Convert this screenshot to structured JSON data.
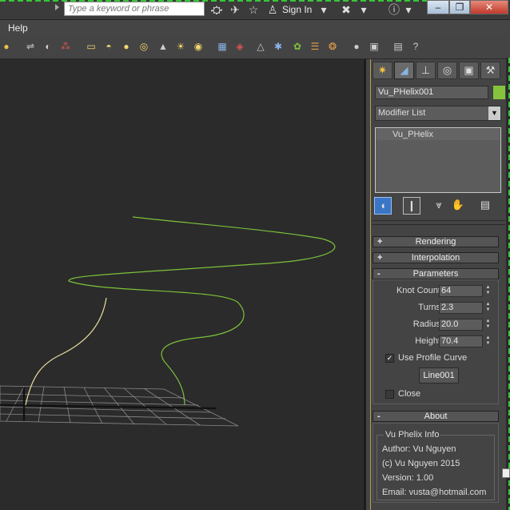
{
  "search": {
    "placeholder": "Type a keyword or phrase"
  },
  "titlebar": {
    "signin": "Sign In"
  },
  "menubar": {
    "help": "Help"
  },
  "panel": {
    "object_name": "Vu_PHelix001",
    "object_color": "#86c33c",
    "modifier_list": "Modifier List",
    "stack_items": [
      "Vu_PHelix"
    ],
    "rollouts": {
      "rendering": "Rendering",
      "interpolation": "Interpolation",
      "parameters": "Parameters",
      "about": "About"
    },
    "rollout_signs": {
      "collapsed": "+",
      "expanded": "-"
    },
    "parameters": {
      "knot_count": {
        "label": "Knot Count",
        "value": "64"
      },
      "turns": {
        "label": "Turns",
        "value": "2.3"
      },
      "radius": {
        "label": "Radius",
        "value": "20.0"
      },
      "height": {
        "label": "Height",
        "value": "70.4"
      },
      "use_profile_curve": {
        "label": "Use Profile Curve",
        "checked": true
      },
      "profile_button": "Line001",
      "close": {
        "label": "Close",
        "checked": false
      }
    },
    "about": {
      "group_title": "Vu Phelix Info",
      "author": "Author: Vu Nguyen",
      "copyright": "(c) Vu Nguyen 2015",
      "version": "Version: 1.00",
      "email": "Email: vusta@hotmail.com"
    }
  },
  "colors": {
    "helix": "#7cc23a",
    "profile_curve": "#e8e0a0",
    "grid": "#8a8a8a",
    "viewport_bg": "#2b2b2b",
    "panel_accent": "#b8a24a"
  }
}
